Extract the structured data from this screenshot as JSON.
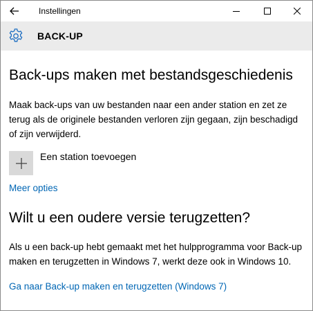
{
  "window": {
    "app_title": "Instellingen",
    "icons": {
      "back": "back-arrow-icon",
      "minimize": "minimize-icon",
      "maximize": "maximize-icon",
      "close": "close-icon"
    }
  },
  "header": {
    "icon": "gear-icon",
    "title": "BACK-UP"
  },
  "section_file_history": {
    "title": "Back-ups maken met bestandsgeschiedenis",
    "description": "Maak back-ups van uw bestanden naar een ander station en zet ze terug als de originele bestanden verloren zijn gegaan, zijn beschadigd of zijn verwijderd.",
    "add_drive_label": "Een station toevoegen",
    "add_icon": "plus-icon",
    "more_options_link": "Meer opties"
  },
  "section_older_backup": {
    "title": "Wilt u een oudere versie terugzetten?",
    "description": "Als u een back-up hebt gemaakt met het hulpprogramma voor Back-up maken en terugzetten in Windows 7, werkt deze ook in Windows 10.",
    "link": "Ga naar Back-up maken en terugzetten (Windows 7)"
  },
  "colors": {
    "header_background": "#ebebeb",
    "accent_link": "#0066b4",
    "gear_icon": "#1f6fc2",
    "add_tile": "#d9d9d9"
  }
}
